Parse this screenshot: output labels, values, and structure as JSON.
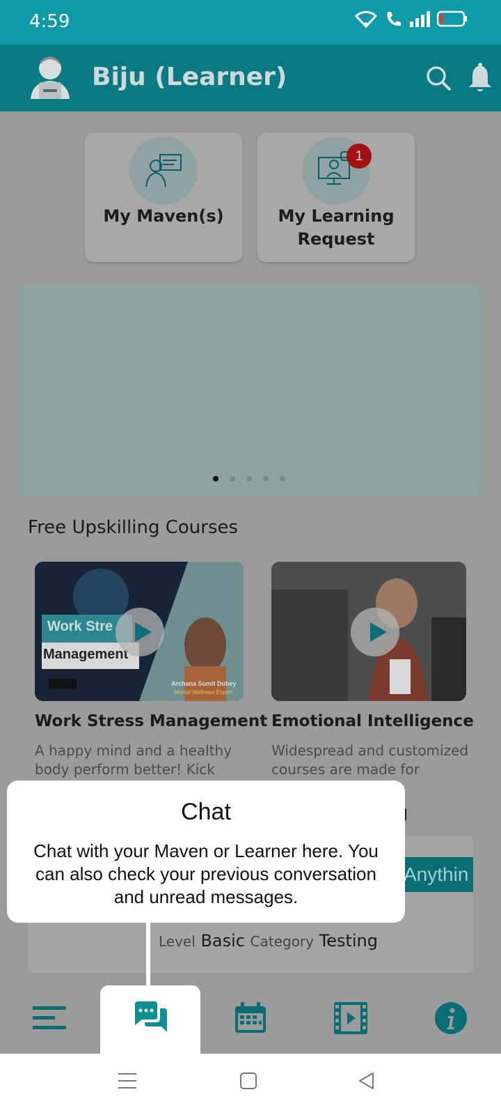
{
  "status_bar": {
    "time": "4:59"
  },
  "header": {
    "title": "Biju (Learner)"
  },
  "quick_actions": [
    {
      "label": "My Maven(s)"
    },
    {
      "label": "My Learning Request",
      "badge": "1"
    }
  ],
  "carousel": {
    "dot_count": 5,
    "active_index": 0
  },
  "courses_section": {
    "title": "Free Upskilling Courses",
    "courses": [
      {
        "title": "Work Stress Management",
        "description": "A happy mind and a healthy body perform better! Kick ou...",
        "thumb_text_1": "Work Stre",
        "thumb_text_2": "Management",
        "presenter": "Archana Sumit Dubey",
        "presenter_role": "Mental Wellness Expert"
      },
      {
        "title": "Emotional Intelligence",
        "description": "Widespread and customized courses are made for professi."
      }
    ]
  },
  "behind_card": {
    "heading_tail": "g",
    "tag": "Anythin",
    "level_label": "Level",
    "level_value": "Basic",
    "category_label": "Category",
    "category_value": "Testing"
  },
  "tooltip": {
    "title": "Chat",
    "body": "Chat with your Maven or Learner here. You can also check your previous conversation and unread messages."
  },
  "bottom_nav": {
    "items": [
      {
        "icon": "menu-icon"
      },
      {
        "icon": "chat-icon",
        "active": true
      },
      {
        "icon": "calendar-icon"
      },
      {
        "icon": "video-icon"
      },
      {
        "icon": "info-icon"
      }
    ]
  },
  "colors": {
    "brand": "#0e9aa7",
    "brand_dark": "#0a7a82",
    "badge": "#a31212"
  }
}
